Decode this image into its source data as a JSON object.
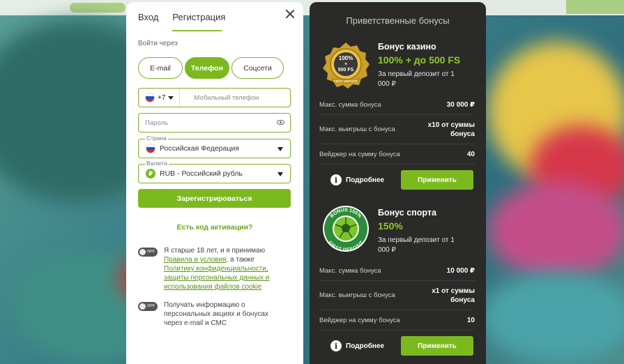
{
  "registration": {
    "tabs": [
      {
        "label": "Вход"
      },
      {
        "label": "Регистрация"
      }
    ],
    "via_label": "Войти через",
    "methods": [
      {
        "label": "E-mail"
      },
      {
        "label": "Телефон"
      },
      {
        "label": "Соцсети"
      }
    ],
    "phone": {
      "code": "+7",
      "placeholder": "Мобильный телефон"
    },
    "password": {
      "placeholder": "Пароль"
    },
    "country": {
      "label": "Страна",
      "value": "Российская Федерация"
    },
    "currency": {
      "label": "Валюта",
      "value": "RUB - Российский рубль",
      "symbol": "₽"
    },
    "register_button": "Зарегистрироваться",
    "activation_link": "Есть код активации?",
    "toggle_off_label": "OFF",
    "consent1": {
      "prefix": "Я старше 18 лет, и я принимаю ",
      "link1": "Правила и условия",
      "middle": ", а также ",
      "link2": "Политику конфиденциальности, защиты персональных данных и использования файлов cookie"
    },
    "consent2": "Получать информацию о персональных акциях и бонусах через e-mail и СМС"
  },
  "bonuses": {
    "title": "Приветственные бонусы",
    "casino": {
      "badge_line1": "100%",
      "badge_line2": "+",
      "badge_line3": "500 FS",
      "badge_ribbon": "FIRST DEPOSIT",
      "name": "Бонус казино",
      "amount": "100% + до 500 FS",
      "desc": "За первый депозит от 1 000 ₽",
      "rows": [
        {
          "label": "Макс. сумма бонуса",
          "value": "30 000 ₽"
        },
        {
          "label": "Макс. выигрыш с бонуса",
          "value": "x10 от суммы бонуса"
        },
        {
          "label": "Вейджер на сумму бонуса",
          "value": "40"
        }
      ],
      "more": "Подробнее",
      "apply": "Применить"
    },
    "sport": {
      "badge_top": "BONUS 150%",
      "badge_bottom": "FIRST DEPOSIT",
      "name": "Бонус спорта",
      "amount": "150%",
      "desc": "За первый депозит от 1 000 ₽",
      "rows": [
        {
          "label": "Макс. сумма бонуса",
          "value": "10 000 ₽"
        },
        {
          "label": "Макс. выигрыш с бонуса",
          "value": "x1 от суммы бонуса"
        },
        {
          "label": "Вейджер на сумму бонуса",
          "value": "10"
        }
      ],
      "more": "Подробнее",
      "apply": "Применить"
    }
  },
  "colors": {
    "accent": "#7cb91f",
    "panel": "#2a2a28",
    "bonus_amount": "#8fc92c",
    "link": "#5c8f14"
  }
}
